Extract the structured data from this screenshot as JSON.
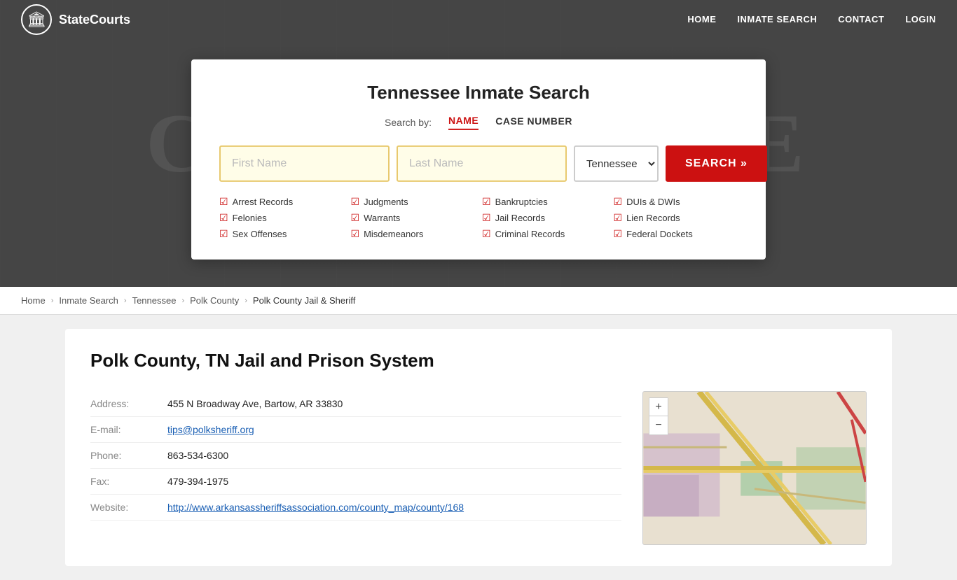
{
  "site": {
    "logo_text": "StateCourts",
    "logo_icon": "🏛"
  },
  "navbar": {
    "links": [
      {
        "label": "HOME",
        "href": "#"
      },
      {
        "label": "INMATE SEARCH",
        "href": "#"
      },
      {
        "label": "CONTACT",
        "href": "#"
      },
      {
        "label": "LOGIN",
        "href": "#"
      }
    ]
  },
  "hero_text": "COURTHOUSE",
  "search_card": {
    "title": "Tennessee Inmate Search",
    "search_by_label": "Search by:",
    "tab_name": "NAME",
    "tab_case": "CASE NUMBER",
    "first_name_placeholder": "First Name",
    "last_name_placeholder": "Last Name",
    "state_value": "Tennessee",
    "search_button": "SEARCH »",
    "checkboxes": [
      "Arrest Records",
      "Judgments",
      "Bankruptcies",
      "DUIs & DWIs",
      "Felonies",
      "Warrants",
      "Jail Records",
      "Lien Records",
      "Sex Offenses",
      "Misdemeanors",
      "Criminal Records",
      "Federal Dockets"
    ]
  },
  "breadcrumb": {
    "items": [
      {
        "label": "Home",
        "href": "#"
      },
      {
        "label": "Inmate Search",
        "href": "#"
      },
      {
        "label": "Tennessee",
        "href": "#"
      },
      {
        "label": "Polk County",
        "href": "#"
      },
      {
        "label": "Polk County Jail & Sheriff",
        "current": true
      }
    ]
  },
  "page": {
    "title": "Polk County, TN Jail and Prison System",
    "address_label": "Address:",
    "address_value": "455 N Broadway Ave, Bartow, AR 33830",
    "email_label": "E-mail:",
    "email_value": "tips@polksheriff.org",
    "email_href": "mailto:tips@polksheriff.org",
    "phone_label": "Phone:",
    "phone_value": "863-534-6300",
    "fax_label": "Fax:",
    "fax_value": "479-394-1975",
    "website_label": "Website:",
    "website_value": "http://www.arkansassheriffsassociation.com/county_map/county/168",
    "website_href": "http://www.arkansassheriffsassociation.com/county_map/county/168"
  },
  "map": {
    "zoom_in": "+",
    "zoom_out": "−"
  }
}
